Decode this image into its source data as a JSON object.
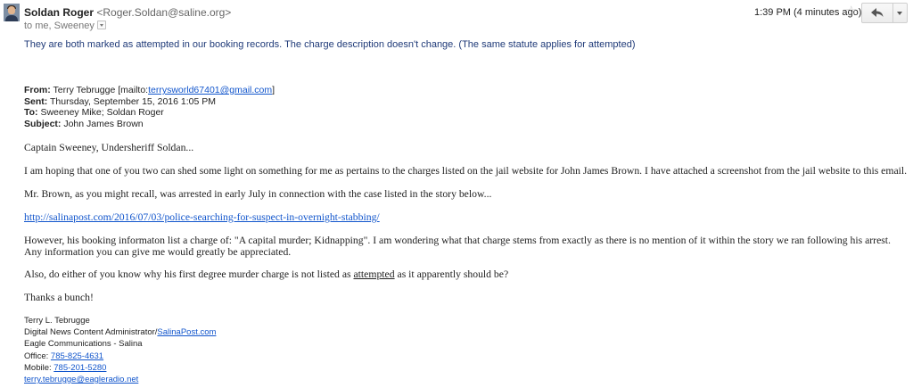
{
  "message": {
    "sender_name": "Soldan Roger",
    "sender_email": "<Roger.Soldan@saline.org>",
    "to_line": "to me, Sweeney",
    "time": "1:39 PM (4 minutes ago)",
    "intro": "They are both marked as attempted in our booking records. The charge description doesn't change. (The same statute applies for attempted)"
  },
  "quoted_header": {
    "from_label": "From:",
    "from_value": "Terry Tebrugge [mailto:",
    "from_link": "terrysworld67401@gmail.com",
    "from_close": "]",
    "sent_label": "Sent:",
    "sent_value": "Thursday, September 15, 2016 1:05 PM",
    "to_label": "To:",
    "to_value": "Sweeney Mike; Soldan Roger",
    "subject_label": "Subject:",
    "subject_value": "John James Brown"
  },
  "body": {
    "greeting": "Captain Sweeney, Undersheriff Soldan...",
    "p1": "I am hoping that one of you two can shed some light on something for me as pertains to the charges listed on the jail website for John James Brown. I have attached a screenshot from the jail website to this email.",
    "p2": "Mr. Brown, as you might recall, was arrested in early July in connection with the case listed in the story below...",
    "link": "http://salinapost.com/2016/07/03/police-searching-for-suspect-in-overnight-stabbing/",
    "p3_line1": "However, his booking informaton list a charge of: \"A capital murder; Kidnapping\". I am wondering what that charge stems from exactly as there is no mention of it within the story we ran following his arrest.",
    "p3_line2": "Any information you can give me would greatly be appreciated.",
    "p4_pre": "Also, do either of you know why his first degree murder charge is not listed as ",
    "p4_underlined": "attempted",
    "p4_post": " as it apparently should be?",
    "thanks": "Thanks a bunch!"
  },
  "signature": {
    "name": "Terry L. Tebrugge",
    "title_pre": "Digital News Content Administrator/",
    "title_link": "SalinaPost.com",
    "company": "Eagle Communications - Salina",
    "office_label": "Office: ",
    "office_phone": "785-825-4631",
    "mobile_label": "Mobile: ",
    "mobile_phone": "785-201-5280",
    "email": "terry.tebrugge@eagleradio.net"
  },
  "icons": {
    "star": "star-icon",
    "reply": "reply-arrow-icon",
    "more": "chevron-down-icon",
    "details": "chevron-down-icon",
    "avatar": "avatar"
  },
  "colors": {
    "intro_text": "#1f3a78",
    "link": "#1155cc"
  }
}
